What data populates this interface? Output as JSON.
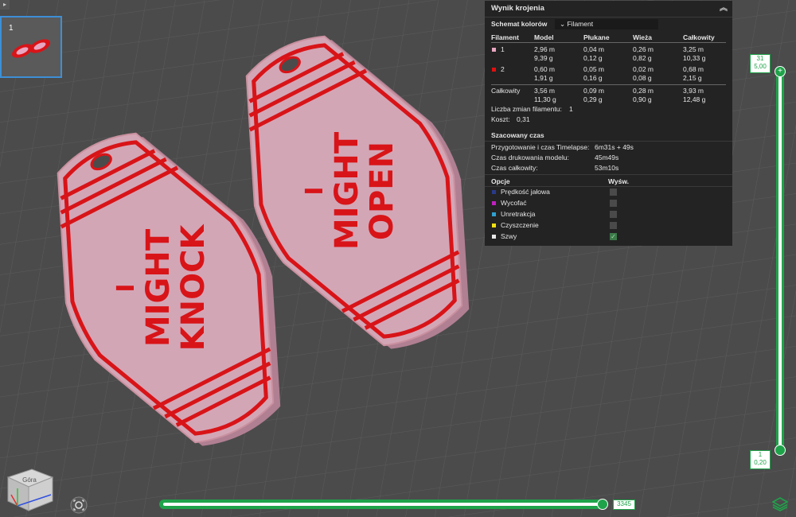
{
  "viewport": {
    "tag_left": [
      "I",
      "MIGHT",
      "KNOCK"
    ],
    "tag_right": [
      "I",
      "MIGHT",
      "OPEN"
    ]
  },
  "thumbnail": {
    "plate_number": "1"
  },
  "panel": {
    "title": "Wynik krojenia",
    "scheme_label": "Schemat kolorów",
    "scheme_value": "Filament",
    "columns": [
      "Filament",
      "Model",
      "Płukane",
      "Wieża",
      "Całkowity"
    ],
    "rows": [
      {
        "filament": "1",
        "color": "#e8a6c0",
        "model": [
          "2,96 m",
          "9,39 g"
        ],
        "flush": [
          "0,04 m",
          "0,12 g"
        ],
        "tower": [
          "0,26 m",
          "0,82 g"
        ],
        "total": [
          "3,25 m",
          "10,33 g"
        ]
      },
      {
        "filament": "2",
        "color": "#e01010",
        "model": [
          "0,60 m",
          "1,91 g"
        ],
        "flush": [
          "0,05 m",
          "0,16 g"
        ],
        "tower": [
          "0,02 m",
          "0,08 g"
        ],
        "total": [
          "0,68 m",
          "2,15 g"
        ]
      }
    ],
    "total_row": {
      "label": "Całkowity",
      "model": [
        "3,56 m",
        "11,30 g"
      ],
      "flush": [
        "0,09 m",
        "0,29 g"
      ],
      "tower": [
        "0,28 m",
        "0,90 g"
      ],
      "total": [
        "3,93 m",
        "12,48 g"
      ]
    },
    "filament_changes_label": "Liczba zmian filamentu:",
    "filament_changes_value": "1",
    "cost_label": "Koszt:",
    "cost_value": "0,31",
    "time_heading": "Szacowany czas",
    "times": [
      {
        "label": "Przygotowanie i czas Timelapse:",
        "value": "6m31s + 49s"
      },
      {
        "label": "Czas drukowania modelu:",
        "value": "45m49s"
      },
      {
        "label": "Czas całkowity:",
        "value": "53m10s"
      }
    ],
    "options_heading": "Opcje",
    "display_heading": "Wyśw.",
    "options": [
      {
        "label": "Prędkość jałowa",
        "color": "#2a3a8a",
        "checked": false
      },
      {
        "label": "Wycofać",
        "color": "#c020c0",
        "checked": false
      },
      {
        "label": "Unretrakcja",
        "color": "#30a0d0",
        "checked": false
      },
      {
        "label": "Czyszczenie",
        "color": "#f0e010",
        "checked": false
      },
      {
        "label": "Szwy",
        "color": "#e8e8e8",
        "checked": true
      }
    ]
  },
  "vertical_slider": {
    "top_layer": "31",
    "top_height": "5,00",
    "bottom_layer": "1",
    "bottom_height": "0,20"
  },
  "horizontal_slider": {
    "value": "3345"
  },
  "view_cube": {
    "face_label": "Góra"
  },
  "colors": {
    "accent": "#1fa34a",
    "filament_1": "#e8a6c0",
    "filament_2": "#e01010"
  }
}
